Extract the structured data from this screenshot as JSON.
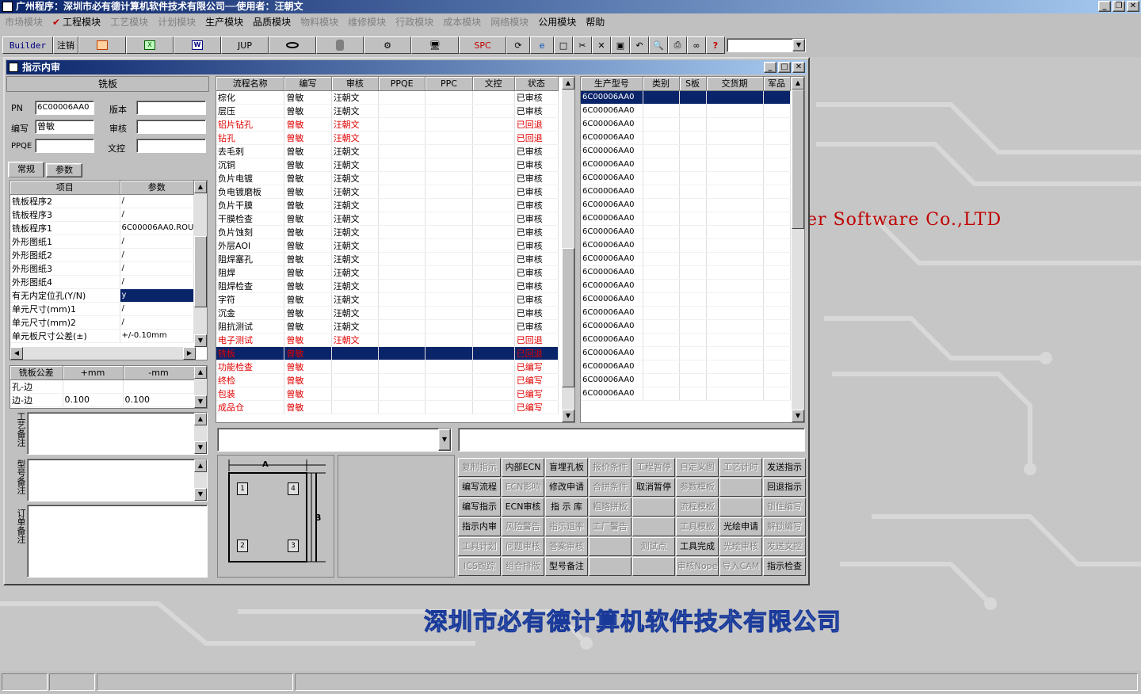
{
  "app_title": "广州程序：深圳市必有德计算机软件技术有限公司──使用者：汪朝文",
  "menus": [
    {
      "label": "市场模块",
      "enabled": false
    },
    {
      "label": "工程模块",
      "enabled": true
    },
    {
      "label": "工艺模块",
      "enabled": false
    },
    {
      "label": "计划模块",
      "enabled": false
    },
    {
      "label": "生产模块",
      "enabled": true
    },
    {
      "label": "品质模块",
      "enabled": true
    },
    {
      "label": "物料模块",
      "enabled": false
    },
    {
      "label": "维修模块",
      "enabled": false
    },
    {
      "label": "行政模块",
      "enabled": false
    },
    {
      "label": "成本模块",
      "enabled": false
    },
    {
      "label": "网络模块",
      "enabled": false
    },
    {
      "label": "公用模块",
      "enabled": true
    },
    {
      "label": "帮助",
      "enabled": true
    }
  ],
  "toolbar": {
    "builder": "Builder",
    "logout": "注销",
    "jup": "JUP",
    "spc": "SPC",
    "help_glyph": "?"
  },
  "background": {
    "en_text": "er Software Co.,LTD",
    "cn_text": "深圳市必有德计算机软件技术有限公司"
  },
  "window": {
    "title": "指示内审",
    "section_title": "铣板",
    "pn_label": "PN",
    "pn_value": "6C00006AA0",
    "version_label": "版本",
    "version_value": "",
    "writer_label": "编写",
    "writer_value": "曾敏",
    "review_label": "审核",
    "review_value": "",
    "ppqe_label": "PPQE",
    "ppqe_value": "",
    "doc_label": "文控",
    "doc_value": "",
    "tab_normal": "常规",
    "tab_param": "参数"
  },
  "param_table": {
    "headers": [
      "项目",
      "参数"
    ],
    "rows": [
      [
        "铣板程序2",
        "/"
      ],
      [
        "铣板程序3",
        "/"
      ],
      [
        "铣板程序1",
        "6C00006AA0.ROU"
      ],
      [
        "外形图纸1",
        "/"
      ],
      [
        "外形图纸2",
        "/"
      ],
      [
        "外形图纸3",
        "/"
      ],
      [
        "外形图纸4",
        "/"
      ],
      [
        "有无内定位孔(Y/N)",
        "y"
      ],
      [
        "单元尺寸(mm)1",
        "/"
      ],
      [
        "单元尺寸(mm)2",
        "/"
      ],
      [
        "单元板尺寸公差(±)",
        "+/-0.10mm"
      ]
    ],
    "selected_index": 7
  },
  "tolerance_table": {
    "headers": [
      "铣板公差",
      "+mm",
      "-mm"
    ],
    "rows": [
      [
        "孔-边",
        "",
        ""
      ],
      [
        "边-边",
        "0.100",
        "0.100"
      ]
    ]
  },
  "notes": {
    "process_label": "工艺备注",
    "model_label": "型号备注",
    "order_label": "订单备注"
  },
  "flow_table": {
    "headers": [
      "流程名称",
      "编写",
      "审核",
      "PPQE",
      "PPC",
      "文控",
      "状态"
    ],
    "rows": [
      {
        "cells": [
          "棕化",
          "曾敏",
          "汪朝文",
          "",
          "",
          "",
          "已审核"
        ],
        "style": "normal"
      },
      {
        "cells": [
          "层压",
          "曾敏",
          "汪朝文",
          "",
          "",
          "",
          "已审核"
        ],
        "style": "normal"
      },
      {
        "cells": [
          "铝片钻孔",
          "曾敏",
          "汪朝文",
          "",
          "",
          "",
          "已回退"
        ],
        "style": "red"
      },
      {
        "cells": [
          "钻孔",
          "曾敏",
          "汪朝文",
          "",
          "",
          "",
          "已回退"
        ],
        "style": "red"
      },
      {
        "cells": [
          "去毛刺",
          "曾敏",
          "汪朝文",
          "",
          "",
          "",
          "已审核"
        ],
        "style": "normal"
      },
      {
        "cells": [
          "沉铜",
          "曾敏",
          "汪朝文",
          "",
          "",
          "",
          "已审核"
        ],
        "style": "normal"
      },
      {
        "cells": [
          "负片电镀",
          "曾敏",
          "汪朝文",
          "",
          "",
          "",
          "已审核"
        ],
        "style": "normal"
      },
      {
        "cells": [
          "负电镀磨板",
          "曾敏",
          "汪朝文",
          "",
          "",
          "",
          "已审核"
        ],
        "style": "normal"
      },
      {
        "cells": [
          "负片干膜",
          "曾敏",
          "汪朝文",
          "",
          "",
          "",
          "已审核"
        ],
        "style": "normal"
      },
      {
        "cells": [
          "干膜检查",
          "曾敏",
          "汪朝文",
          "",
          "",
          "",
          "已审核"
        ],
        "style": "normal"
      },
      {
        "cells": [
          "负片蚀刻",
          "曾敏",
          "汪朝文",
          "",
          "",
          "",
          "已审核"
        ],
        "style": "normal"
      },
      {
        "cells": [
          "外层AOI",
          "曾敏",
          "汪朝文",
          "",
          "",
          "",
          "已审核"
        ],
        "style": "normal"
      },
      {
        "cells": [
          "阻焊塞孔",
          "曾敏",
          "汪朝文",
          "",
          "",
          "",
          "已审核"
        ],
        "style": "normal"
      },
      {
        "cells": [
          "阻焊",
          "曾敏",
          "汪朝文",
          "",
          "",
          "",
          "已审核"
        ],
        "style": "normal"
      },
      {
        "cells": [
          "阻焊检查",
          "曾敏",
          "汪朝文",
          "",
          "",
          "",
          "已审核"
        ],
        "style": "normal"
      },
      {
        "cells": [
          "字符",
          "曾敏",
          "汪朝文",
          "",
          "",
          "",
          "已审核"
        ],
        "style": "normal"
      },
      {
        "cells": [
          "沉金",
          "曾敏",
          "汪朝文",
          "",
          "",
          "",
          "已审核"
        ],
        "style": "normal"
      },
      {
        "cells": [
          "阻抗测试",
          "曾敏",
          "汪朝文",
          "",
          "",
          "",
          "已审核"
        ],
        "style": "normal"
      },
      {
        "cells": [
          "电子测试",
          "曾敏",
          "汪朝文",
          "",
          "",
          "",
          "已回退"
        ],
        "style": "red"
      },
      {
        "cells": [
          "铣板",
          "曾敏",
          "",
          "",
          "",
          "",
          "已回退"
        ],
        "style": "sel"
      },
      {
        "cells": [
          "功能检查",
          "曾敏",
          "",
          "",
          "",
          "",
          "已编写"
        ],
        "style": "red"
      },
      {
        "cells": [
          "终检",
          "曾敏",
          "",
          "",
          "",
          "",
          "已编写"
        ],
        "style": "red"
      },
      {
        "cells": [
          "包装",
          "曾敏",
          "",
          "",
          "",
          "",
          "已编写"
        ],
        "style": "red"
      },
      {
        "cells": [
          "成品仓",
          "曾敏",
          "",
          "",
          "",
          "",
          "已编写"
        ],
        "style": "red"
      }
    ]
  },
  "model_table": {
    "headers": [
      "生产型号",
      "类别",
      "S板",
      "交货期",
      "军品"
    ],
    "rows": [
      "6C00006AA0",
      "6C00006AA0",
      "6C00006AA0",
      "6C00006AA0",
      "6C00006AA0",
      "6C00006AA0",
      "6C00006AA0",
      "6C00006AA0",
      "6C00006AA0",
      "6C00006AA0",
      "6C00006AA0",
      "6C00006AA0",
      "6C00006AA0",
      "6C00006AA0",
      "6C00006AA0",
      "6C00006AA0",
      "6C00006AA0",
      "6C00006AA0",
      "6C00006AA0",
      "6C00006AA0",
      "6C00006AA0",
      "6C00006AA0",
      "6C00006AA0"
    ]
  },
  "diagram": {
    "a": "A",
    "b": "B",
    "p1": "1",
    "p2": "2",
    "p3": "3",
    "p4": "4"
  },
  "actions": [
    [
      {
        "l": "复制指示",
        "e": false
      },
      {
        "l": "内部ECN",
        "e": true
      },
      {
        "l": "盲埋孔板",
        "e": true
      },
      {
        "l": "报价条件",
        "e": false
      },
      {
        "l": "工程暂停",
        "e": false
      },
      {
        "l": "自定义图",
        "e": false
      },
      {
        "l": "工艺计时",
        "e": false
      },
      {
        "l": "发送指示",
        "e": true
      }
    ],
    [
      {
        "l": "编写流程",
        "e": true
      },
      {
        "l": "ECN影响",
        "e": false
      },
      {
        "l": "修改申请",
        "e": true
      },
      {
        "l": "合拼条件",
        "e": false
      },
      {
        "l": "取消暂停",
        "e": true
      },
      {
        "l": "参数模板",
        "e": false
      },
      {
        "l": "",
        "e": false
      },
      {
        "l": "回退指示",
        "e": true
      }
    ],
    [
      {
        "l": "编写指示",
        "e": true
      },
      {
        "l": "ECN审核",
        "e": true
      },
      {
        "l": "指 示 库",
        "e": true
      },
      {
        "l": "粗略拼板",
        "e": false
      },
      {
        "l": "",
        "e": false
      },
      {
        "l": "流程模板",
        "e": false
      },
      {
        "l": "",
        "e": false
      },
      {
        "l": "锁住编写",
        "e": false
      }
    ],
    [
      {
        "l": "指示内审",
        "e": true
      },
      {
        "l": "风险警告",
        "e": false
      },
      {
        "l": "指示退率",
        "e": false
      },
      {
        "l": "工厂警告",
        "e": false
      },
      {
        "l": "",
        "e": false
      },
      {
        "l": "工具模板",
        "e": false
      },
      {
        "l": "光绘申请",
        "e": true
      },
      {
        "l": "解锁编写",
        "e": false
      }
    ],
    [
      {
        "l": "工具计划",
        "e": false
      },
      {
        "l": "问题审核",
        "e": false
      },
      {
        "l": "答案审核",
        "e": false
      },
      {
        "l": "",
        "e": false
      },
      {
        "l": "测试点",
        "e": false
      },
      {
        "l": "工具完成",
        "e": true
      },
      {
        "l": "光绘审核",
        "e": false
      },
      {
        "l": "发送文控",
        "e": false
      }
    ],
    [
      {
        "l": "ICS跟踪",
        "e": false
      },
      {
        "l": "组合排版",
        "e": false
      },
      {
        "l": "型号备注",
        "e": true
      },
      {
        "l": "",
        "e": false
      },
      {
        "l": "",
        "e": false
      },
      {
        "l": "审核Nope",
        "e": false
      },
      {
        "l": "导入CAM",
        "e": false
      },
      {
        "l": "指示检查",
        "e": true
      }
    ]
  ]
}
